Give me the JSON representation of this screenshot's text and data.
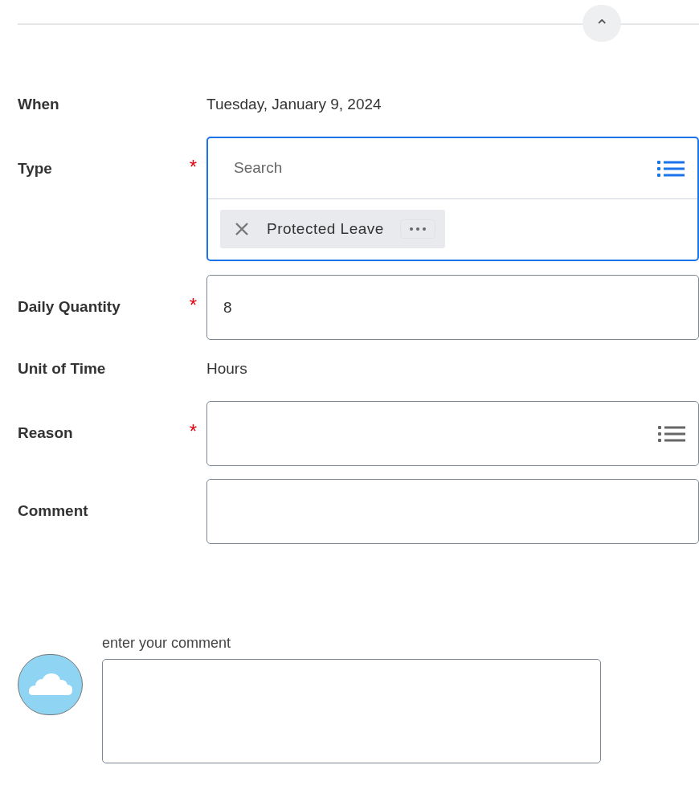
{
  "collapse_button": {
    "glyph": "⌃"
  },
  "fields": [
    {
      "kind": "text",
      "label": "When",
      "value": "Tuesday, January 9, 2024"
    },
    {
      "kind": "multiselect",
      "label": "Type",
      "required_mark": "*",
      "focused": true,
      "placeholder": "Search",
      "chips": [
        "Protected Leave"
      ]
    },
    {
      "kind": "input",
      "label": "Daily Quantity",
      "required_mark": "*",
      "focused": false,
      "value": "8"
    },
    {
      "kind": "text",
      "label": "Unit of Time",
      "value": "Hours"
    },
    {
      "kind": "prompt",
      "label": "Reason",
      "required_mark": "*",
      "focused": false
    },
    {
      "kind": "input",
      "label": "Comment",
      "focused": false
    }
  ],
  "comment_box": {
    "label": "enter your comment"
  }
}
